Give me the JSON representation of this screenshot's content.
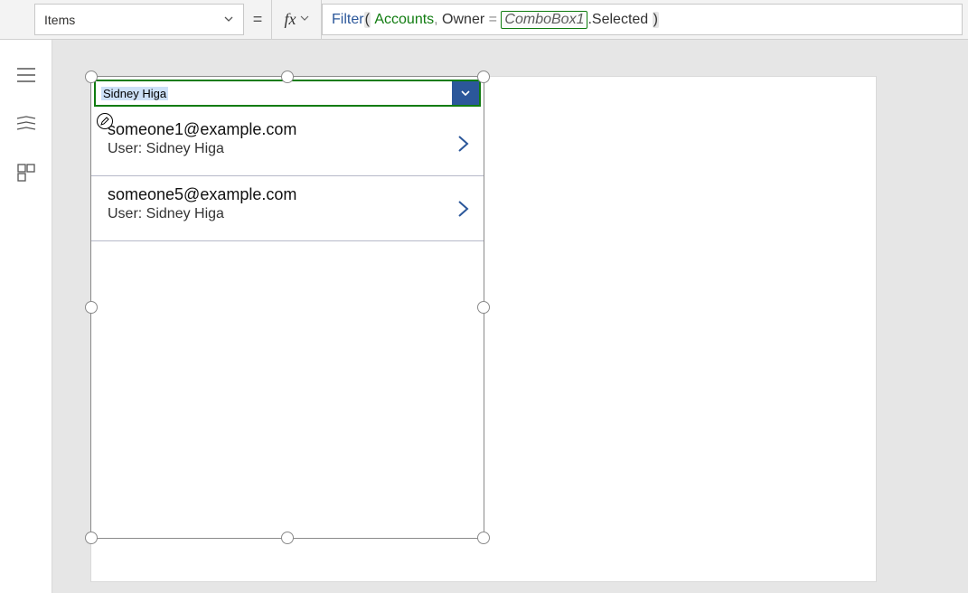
{
  "propertySelector": {
    "label": "Items"
  },
  "formula": {
    "func": "Filter",
    "arg1": "Accounts",
    "owner": "Owner",
    "eq": "=",
    "ref": "ComboBox1",
    "prop": ".Selected"
  },
  "combobox": {
    "selected": "Sidney Higa"
  },
  "rows": [
    {
      "email": "someone1@example.com",
      "sub": "User: Sidney Higa"
    },
    {
      "email": "someone5@example.com",
      "sub": "User: Sidney Higa"
    }
  ]
}
